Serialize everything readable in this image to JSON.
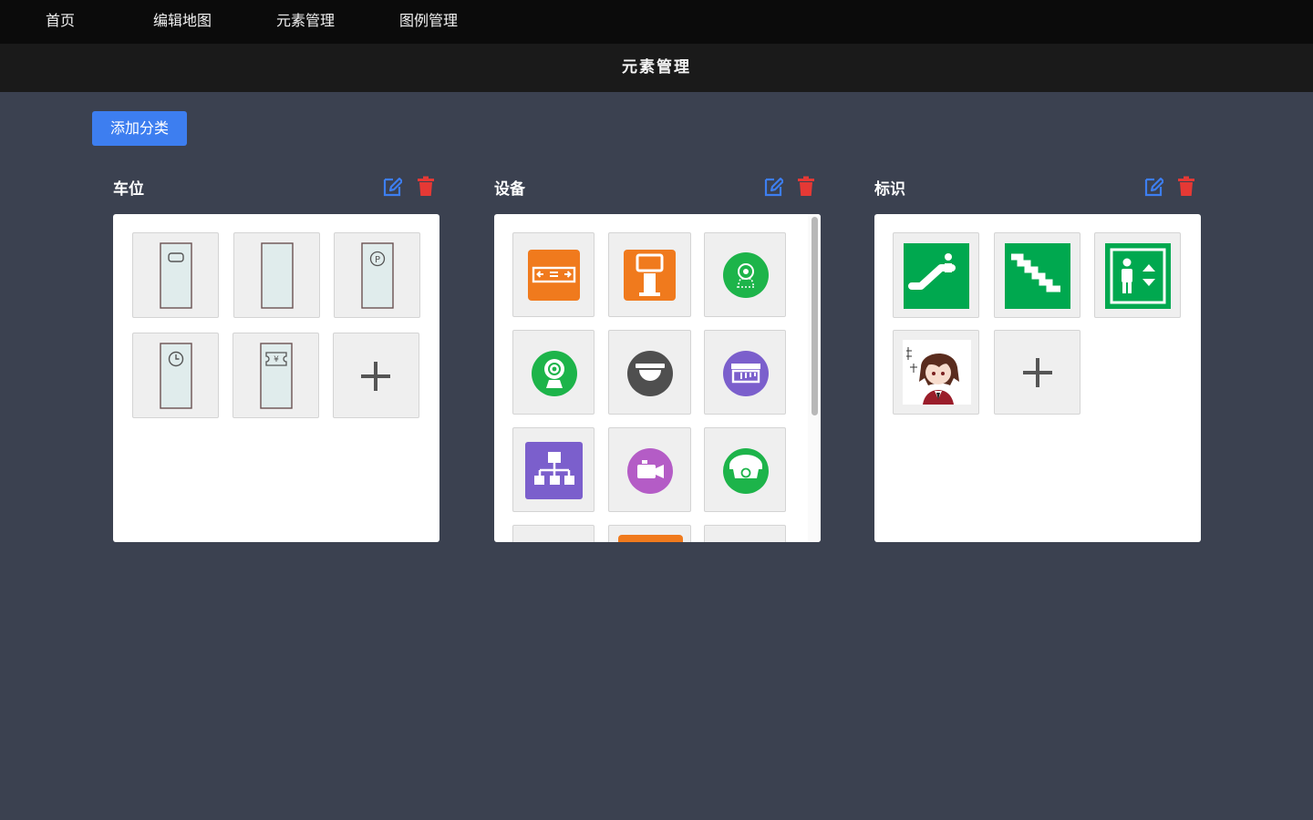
{
  "nav": {
    "items": [
      {
        "label": "首页"
      },
      {
        "label": "编辑地图"
      },
      {
        "label": "元素管理"
      },
      {
        "label": "图例管理"
      }
    ]
  },
  "page_title": "元素管理",
  "add_category_label": "添加分类",
  "colors": {
    "accent": "#3d7ef0",
    "delete": "#e53935",
    "nav_bg": "#0b0b0b",
    "page_bg": "#3b4150",
    "icon_orange": "#f07a1d",
    "icon_green": "#1db44a",
    "icon_purple": "#7b5fcc",
    "icon_dark": "#4f4f4f",
    "icon_magenta": "#b45cc6",
    "sign_green": "#00a84f"
  },
  "categories": [
    {
      "name": "车位",
      "edit_icon": "edit-icon",
      "delete_icon": "trash-icon",
      "items": [
        {
          "icon": "parking-space-icon"
        },
        {
          "icon": "parking-space-plain-icon"
        },
        {
          "icon": "parking-space-p-icon"
        },
        {
          "icon": "parking-space-clock-icon"
        },
        {
          "icon": "parking-space-ticket-icon"
        },
        {
          "icon": "add-icon"
        }
      ]
    },
    {
      "name": "设备",
      "edit_icon": "edit-icon",
      "delete_icon": "trash-icon",
      "items": [
        {
          "icon": "guidance-screen-icon"
        },
        {
          "icon": "kiosk-icon"
        },
        {
          "icon": "camera-icon"
        },
        {
          "icon": "webcam-icon"
        },
        {
          "icon": "dome-camera-icon"
        },
        {
          "icon": "barrier-icon"
        },
        {
          "icon": "network-icon"
        },
        {
          "icon": "video-camera-icon"
        },
        {
          "icon": "face-camera-icon"
        },
        {
          "icon": "device-icon"
        },
        {
          "icon": "device-orange-icon"
        },
        {
          "icon": "device-icon"
        }
      ]
    },
    {
      "name": "标识",
      "edit_icon": "edit-icon",
      "delete_icon": "trash-icon",
      "items": [
        {
          "icon": "escalator-icon"
        },
        {
          "icon": "stairs-icon"
        },
        {
          "icon": "elevator-icon"
        },
        {
          "icon": "anime-avatar-icon"
        },
        {
          "icon": "add-icon"
        }
      ]
    }
  ]
}
